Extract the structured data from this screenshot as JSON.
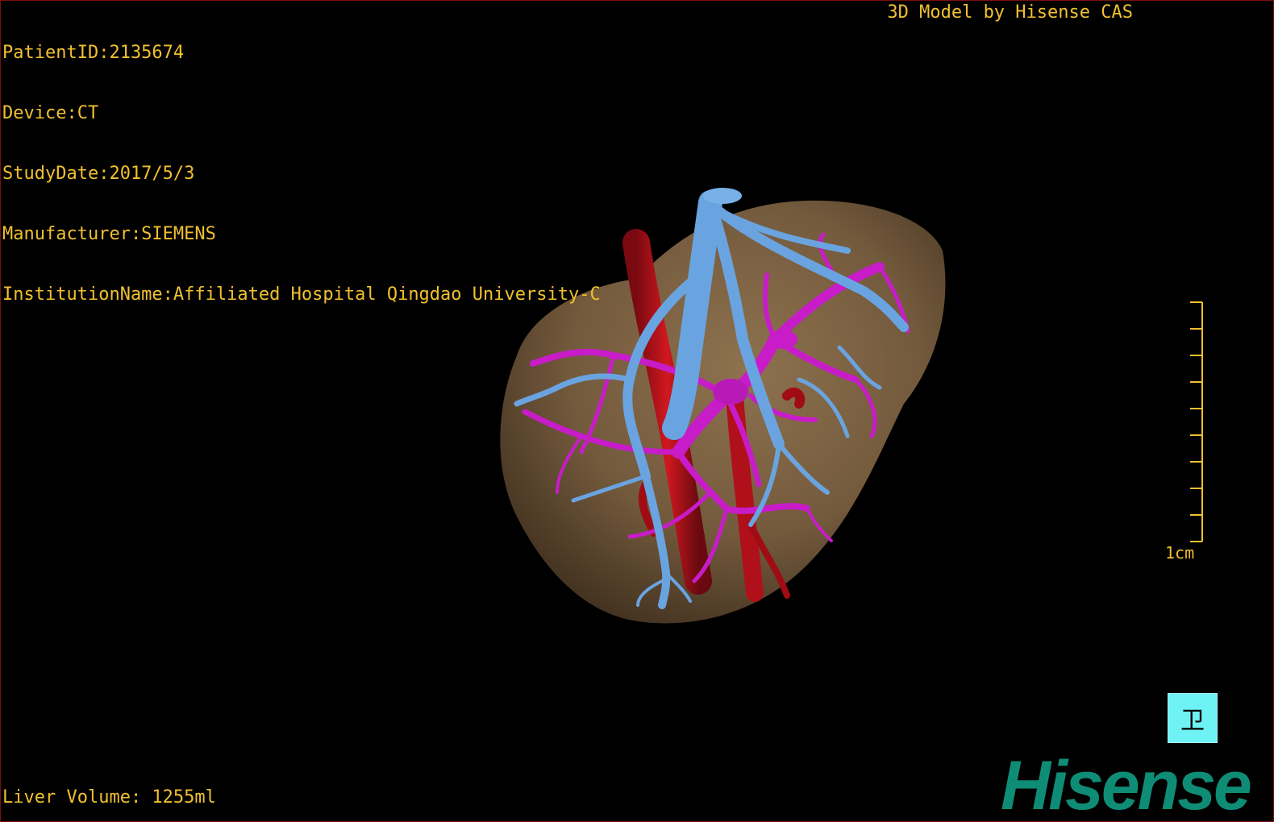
{
  "patient_info": [
    "PatientID:2135674",
    "Device:CT",
    "StudyDate:2017/5/3",
    "Manufacturer:SIEMENS",
    "InstitutionName:Affiliated Hospital Qingdao University-C"
  ],
  "credit": "3D Model by Hisense CAS",
  "liver_volume": "Liver Volume: 1255ml",
  "scale": {
    "label": "1cm"
  },
  "orientation_button": {
    "glyph": "卫"
  },
  "brand": "Hisense",
  "colors": {
    "text": "#f0c030",
    "liver": "#8a6c48",
    "hepatic_vein": "#6aa4e0",
    "portal_vein": "#c81cc8",
    "artery": "#b0101a",
    "brand": "#0f8c76",
    "orientation_button": "#6ff2f4"
  },
  "icons": [
    "liver-model",
    "hepatic-vein",
    "portal-vein",
    "artery",
    "orientation-cube-icon"
  ]
}
